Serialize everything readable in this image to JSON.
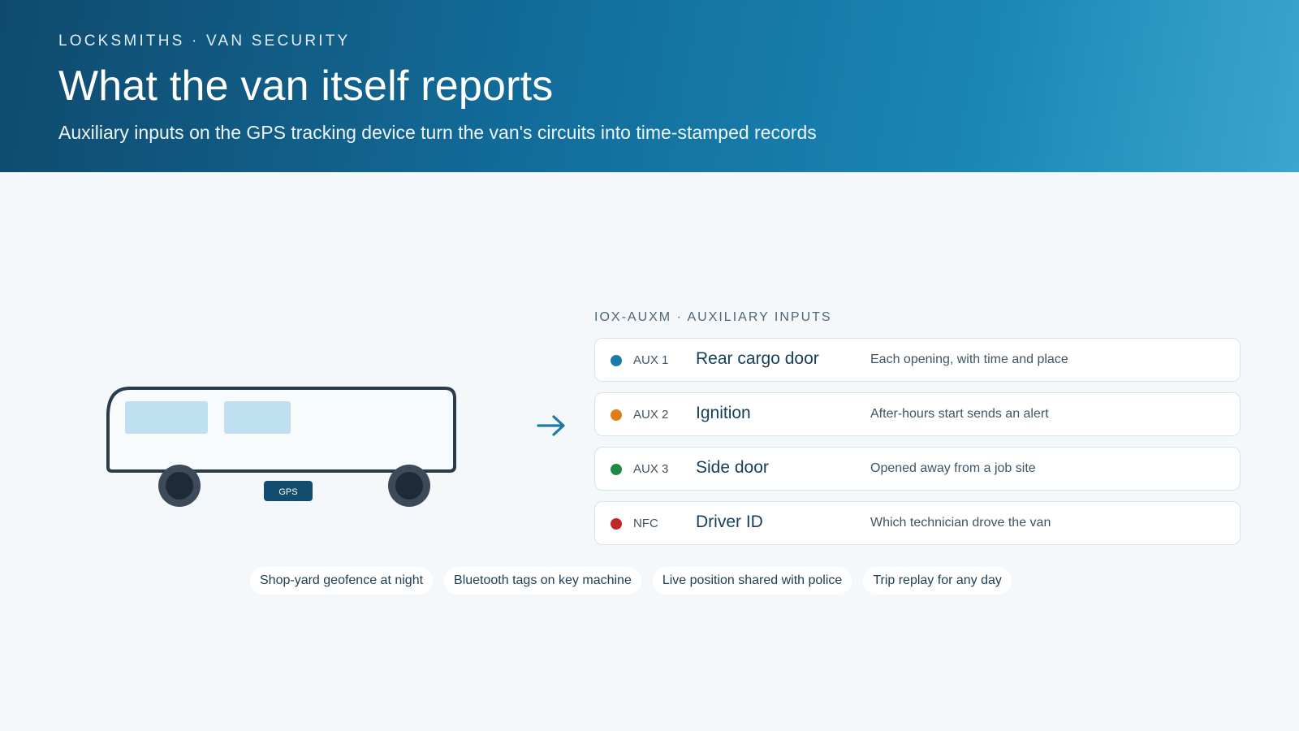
{
  "header": {
    "eyebrow": "LOCKSMITHS · VAN SECURITY",
    "title": "What the van itself reports",
    "subtitle": "Auxiliary inputs on the GPS tracking device turn the van's circuits into time-stamped records"
  },
  "van": {
    "device_label": "GPS",
    "icon": "van-icon",
    "arrow_icon": "arrow-right-icon"
  },
  "panel": {
    "label": "IOX-AUXM · AUXILIARY INPUTS",
    "items": [
      {
        "code": "AUX 1",
        "name": "Rear cargo door",
        "desc": "Each opening, with time and place",
        "color": "#1b7aa8"
      },
      {
        "code": "AUX 2",
        "name": "Ignition",
        "desc": "After-hours start sends an alert",
        "color": "#e07b1a"
      },
      {
        "code": "AUX 3",
        "name": "Side door",
        "desc": "Opened away from a job site",
        "color": "#1f8a48"
      },
      {
        "code": "NFC",
        "name": "Driver ID",
        "desc": "Which technician drove the van",
        "color": "#c0282a"
      }
    ]
  },
  "pills": [
    "Shop-yard geofence at night",
    "Bluetooth tags on key machine",
    "Live position shared with police",
    "Trip replay for any day"
  ],
  "colors": {
    "header_start": "#0f4a6e",
    "header_end": "#3aa6cf",
    "accent": "#1b7aa8",
    "device_badge": "#124d6e"
  }
}
